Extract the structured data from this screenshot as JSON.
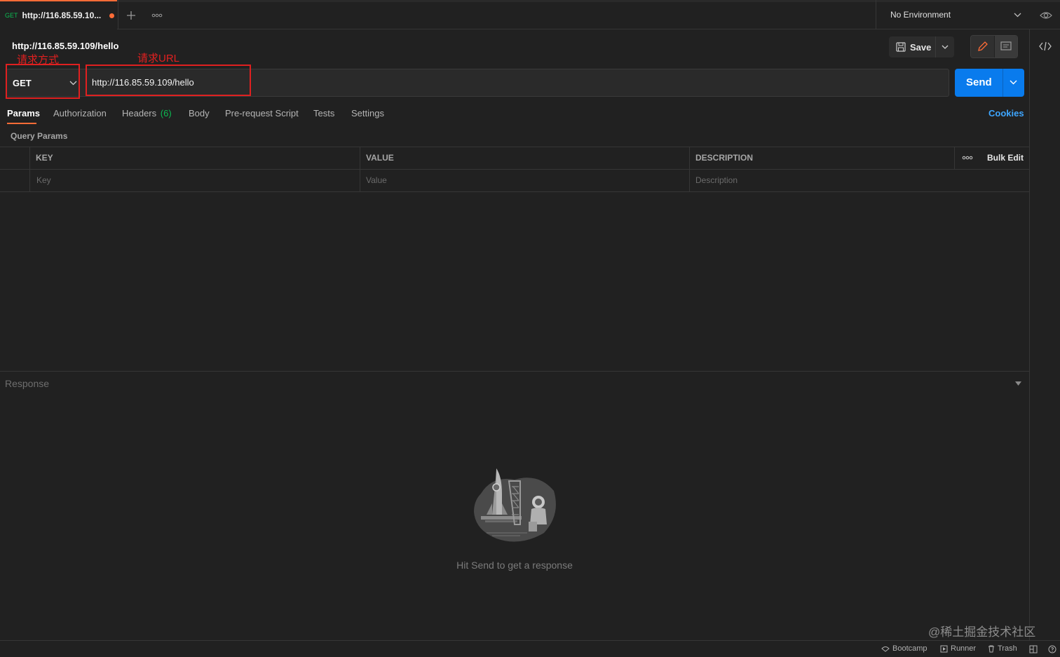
{
  "tab": {
    "method": "GET",
    "title": "http://116.85.59.10..."
  },
  "environment": {
    "selected": "No Environment"
  },
  "request": {
    "title": "http://116.85.59.109/hello",
    "method": "GET",
    "url": "http://116.85.59.109/hello",
    "save_label": "Save",
    "send_label": "Send"
  },
  "annotations": {
    "method_label": "请求方式",
    "url_label": "请求URL"
  },
  "request_tabs": [
    {
      "label": "Params"
    },
    {
      "label": "Authorization"
    },
    {
      "label": "Headers",
      "count": "(6)"
    },
    {
      "label": "Body"
    },
    {
      "label": "Pre-request Script"
    },
    {
      "label": "Tests"
    },
    {
      "label": "Settings"
    }
  ],
  "cookies_label": "Cookies",
  "query_params": {
    "title": "Query Params",
    "columns": [
      "KEY",
      "VALUE",
      "DESCRIPTION"
    ],
    "bulk_edit": "Bulk Edit",
    "placeholders": [
      "Key",
      "Value",
      "Description"
    ]
  },
  "response": {
    "label": "Response",
    "hint": "Hit Send to get a response"
  },
  "statusbar": {
    "bootcamp": "Bootcamp",
    "runner": "Runner",
    "trash": "Trash"
  },
  "watermark": "@稀土掘金技术社区",
  "colors": {
    "accent": "#ff6c37",
    "send": "#097bed",
    "annotation": "#e02020",
    "get": "#0cbb52",
    "link": "#3ea6ff"
  }
}
